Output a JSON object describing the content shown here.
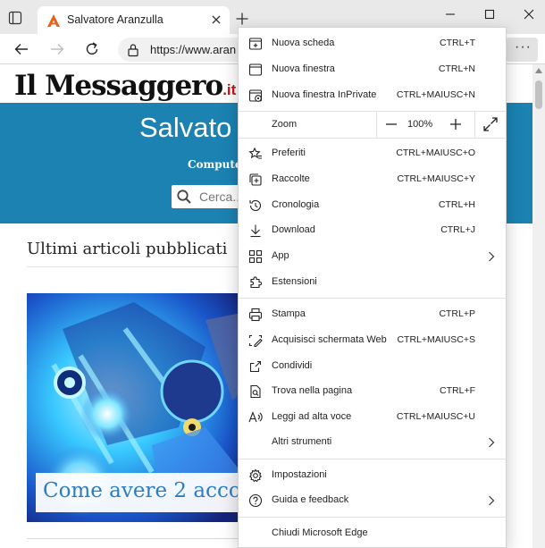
{
  "tab": {
    "title": "Salvatore Aranzulla"
  },
  "address_bar": {
    "url": "https://www.aran"
  },
  "page": {
    "logo_text": "Il Messaggero",
    "logo_suffix": ".it",
    "site_title": "Salvato",
    "tagline": "Computer",
    "search_placeholder": "Cerca...",
    "section_heading": "Ultimi articoli pubblicati",
    "article_title": "Come avere 2 acco"
  },
  "menu": {
    "group1": [
      {
        "label": "Nuova scheda",
        "shortcut": "CTRL+T",
        "icon": "new-tab-icon"
      },
      {
        "label": "Nuova finestra",
        "shortcut": "CTRL+N",
        "icon": "new-window-icon"
      },
      {
        "label": "Nuova finestra InPrivate",
        "shortcut": "CTRL+MAIUSC+N",
        "icon": "inprivate-icon"
      }
    ],
    "zoom": {
      "label": "Zoom",
      "value": "100%"
    },
    "group2": [
      {
        "label": "Preferiti",
        "shortcut": "CTRL+MAIUSC+O",
        "icon": "favorites-icon"
      },
      {
        "label": "Raccolte",
        "shortcut": "CTRL+MAIUSC+Y",
        "icon": "collections-icon"
      },
      {
        "label": "Cronologia",
        "shortcut": "CTRL+H",
        "icon": "history-icon"
      },
      {
        "label": "Download",
        "shortcut": "CTRL+J",
        "icon": "download-icon"
      },
      {
        "label": "App",
        "shortcut": "",
        "icon": "apps-icon",
        "submenu": true
      },
      {
        "label": "Estensioni",
        "shortcut": "",
        "icon": "extensions-icon"
      }
    ],
    "group3": [
      {
        "label": "Stampa",
        "shortcut": "CTRL+P",
        "icon": "print-icon"
      },
      {
        "label": "Acquisisci schermata Web",
        "shortcut": "CTRL+MAIUSC+S",
        "icon": "web-capture-icon"
      },
      {
        "label": "Condividi",
        "shortcut": "",
        "icon": "share-icon"
      },
      {
        "label": "Trova nella pagina",
        "shortcut": "CTRL+F",
        "icon": "find-icon"
      },
      {
        "label": "Leggi ad alta voce",
        "shortcut": "CTRL+MAIUSC+U",
        "icon": "read-aloud-icon"
      },
      {
        "label": "Altri strumenti",
        "shortcut": "",
        "icon": "",
        "submenu": true
      }
    ],
    "group4": [
      {
        "label": "Impostazioni",
        "shortcut": "",
        "icon": "settings-icon"
      },
      {
        "label": "Guida e feedback",
        "shortcut": "",
        "icon": "help-icon",
        "submenu": true
      }
    ],
    "group5": [
      {
        "label": "Chiudi Microsoft Edge",
        "shortcut": "",
        "icon": ""
      }
    ]
  },
  "colors": {
    "hero_background": "#1b82b2",
    "article_title": "#2a7dc0",
    "logo_suffix": "#c4161c",
    "tab_strip": "#e9e9e9",
    "favicon": "#e8611c"
  }
}
